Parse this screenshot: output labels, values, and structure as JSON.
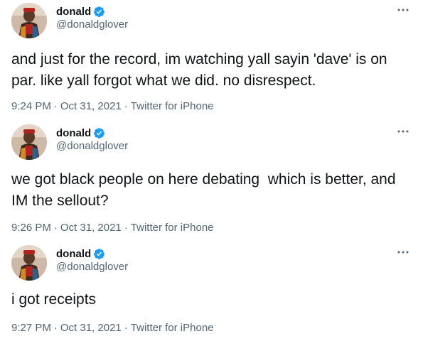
{
  "tweets": [
    {
      "display_name": "donald",
      "handle": "@donaldglover",
      "text": "and just for the record, im watching yall sayin 'dave' is on par. like yall forgot what we did. no disrespect.",
      "time": "9:24 PM",
      "date": "Oct 31, 2021",
      "source": "Twitter for iPhone",
      "separator": "·"
    },
    {
      "display_name": "donald",
      "handle": "@donaldglover",
      "text": "we got black people on here debating  which is better, and IM the sellout?",
      "time": "9:26 PM",
      "date": "Oct 31, 2021",
      "source": "Twitter for iPhone",
      "separator": "·"
    },
    {
      "display_name": "donald",
      "handle": "@donaldglover",
      "text": "i got receipts",
      "time": "9:27 PM",
      "date": "Oct 31, 2021",
      "source": "Twitter for iPhone",
      "separator": "·"
    }
  ],
  "colors": {
    "verified": "#1d9bf0",
    "secondary_text": "#536471",
    "primary_text": "#0f1419"
  },
  "icons": {
    "verified": "verified-badge-icon",
    "more": "more-options-icon"
  }
}
